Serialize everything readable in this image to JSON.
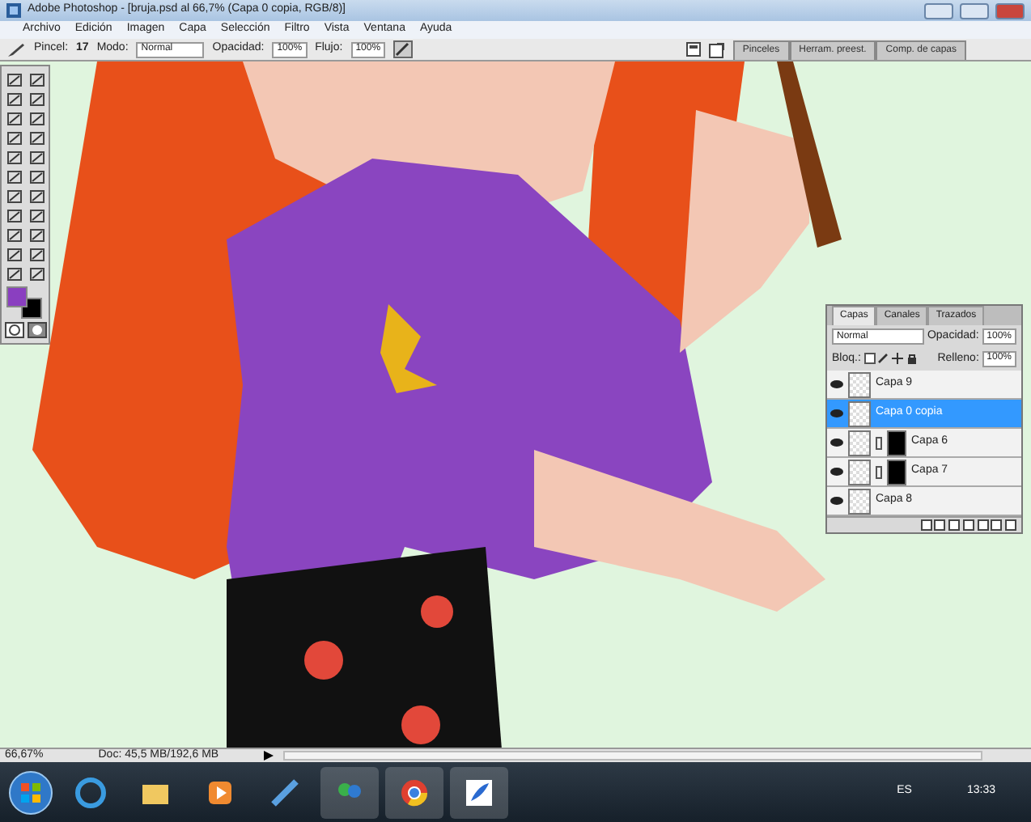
{
  "window": {
    "title": "Adobe Photoshop - [bruja.psd al 66,7% (Capa 0 copia, RGB/8)]"
  },
  "menu": [
    "Archivo",
    "Edición",
    "Imagen",
    "Capa",
    "Selección",
    "Filtro",
    "Vista",
    "Ventana",
    "Ayuda"
  ],
  "options_bar": {
    "brush_label": "Pincel:",
    "brush_size": "17",
    "mode_label": "Modo:",
    "mode": "Normal",
    "opacity_label": "Opacidad:",
    "opacity": "100%",
    "flow_label": "Flujo:",
    "flow": "100%"
  },
  "palette_well_tabs": [
    "Pinceles",
    "Herram. preest.",
    "Comp. de capas"
  ],
  "layers_panel": {
    "tabs": [
      {
        "label": "Capas",
        "selected": true
      },
      {
        "label": "Canales",
        "selected": false
      },
      {
        "label": "Trazados",
        "selected": false
      }
    ],
    "blend_mode": "Normal",
    "opacity_label": "Opacidad:",
    "opacity": "100%",
    "lock_label": "Bloq.:",
    "fill_label": "Relleno:",
    "fill": "100%",
    "layers": [
      {
        "name": "Capa 9",
        "visible": true,
        "selected": false,
        "mask": false
      },
      {
        "name": "Capa 0 copia",
        "visible": true,
        "selected": true,
        "mask": false
      },
      {
        "name": "Capa 6",
        "visible": true,
        "selected": false,
        "mask": true
      },
      {
        "name": "Capa 7",
        "visible": true,
        "selected": false,
        "mask": true
      },
      {
        "name": "Capa 8",
        "visible": true,
        "selected": false,
        "mask": false
      }
    ]
  },
  "status_bar": {
    "zoom": "66,67%",
    "doc": "Doc: 45,5 MB/192,6 MB"
  },
  "taskbar": {
    "language": "ES",
    "clock": "13:33"
  }
}
